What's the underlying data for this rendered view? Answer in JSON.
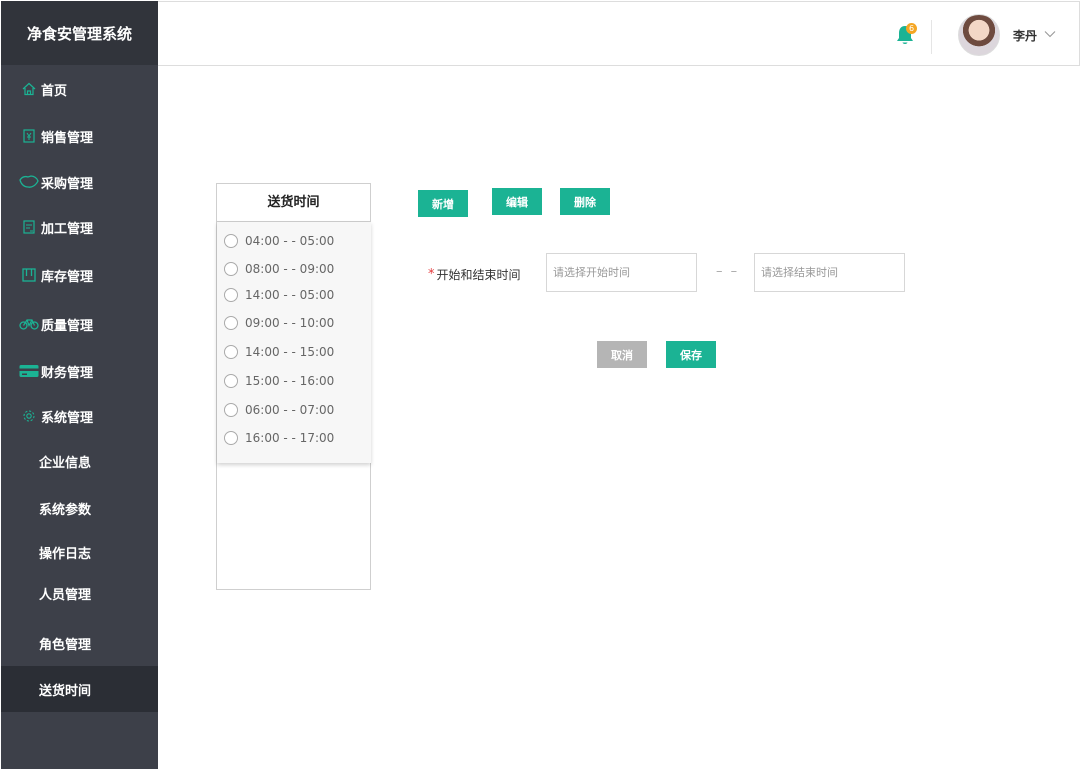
{
  "app": {
    "title": "净食安管理系统"
  },
  "sidebar": {
    "items": [
      {
        "label": "首页",
        "icon": "home-icon"
      },
      {
        "label": "销售管理",
        "icon": "sales-icon"
      },
      {
        "label": "采购管理",
        "icon": "purchase-icon"
      },
      {
        "label": "加工管理",
        "icon": "process-icon"
      },
      {
        "label": "库存管理",
        "icon": "inventory-icon"
      },
      {
        "label": "质量管理",
        "icon": "bike-icon"
      },
      {
        "label": "财务管理",
        "icon": "card-icon"
      },
      {
        "label": "系统管理",
        "icon": "gear-icon"
      }
    ],
    "sub_items": [
      {
        "label": "企业信息"
      },
      {
        "label": "系统参数"
      },
      {
        "label": "操作日志"
      },
      {
        "label": "人员管理"
      },
      {
        "label": "角色管理"
      },
      {
        "label": "送货时间",
        "active": true
      }
    ],
    "icon_color": "#1bb394"
  },
  "header": {
    "notification_count": "6",
    "user_name": "李丹"
  },
  "time_list": {
    "title": "送货时间",
    "slots": [
      "04:00 -  - 05:00",
      "08:00 -  - 09:00",
      "14:00 -  - 05:00",
      "09:00 -  - 10:00",
      "14:00 -  - 15:00",
      "15:00 -  - 16:00",
      "06:00 -  - 07:00",
      "16:00 -  - 17:00"
    ]
  },
  "toolbar": {
    "add_label": "新增",
    "edit_label": "编辑",
    "delete_label": "删除"
  },
  "form": {
    "time_range_label": "开始和结束时间",
    "required_mark": "*",
    "start_placeholder": "请选择开始时间",
    "end_placeholder": "请选择结束时间",
    "separator": "– –",
    "cancel_label": "取消",
    "save_label": "保存"
  },
  "colors": {
    "accent": "#1bb394",
    "sidebar_bg": "#3d4049",
    "badge": "#f5a623",
    "required": "#e4393c"
  }
}
